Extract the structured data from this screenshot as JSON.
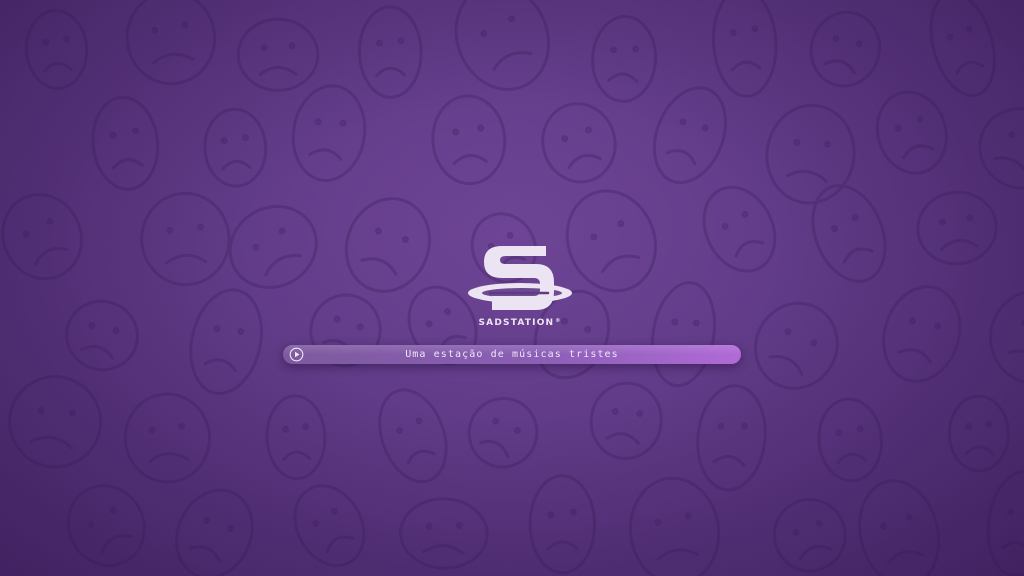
{
  "brand": {
    "name": "SADSTATION",
    "registered_mark": "®",
    "logo_icon": "sadstation-s-saturn-logo-icon"
  },
  "player": {
    "play_icon": "play-circle-icon",
    "tagline": "Uma estação de músicas tristes"
  },
  "background": {
    "pattern_icon": "sad-face-doodle-icon"
  },
  "colors": {
    "background": "#5f3a86",
    "logo": "#ede4f3",
    "bar_start": "#7d5a9e",
    "bar_end": "#b06ad6",
    "doodle_stroke": "#3e2060"
  }
}
